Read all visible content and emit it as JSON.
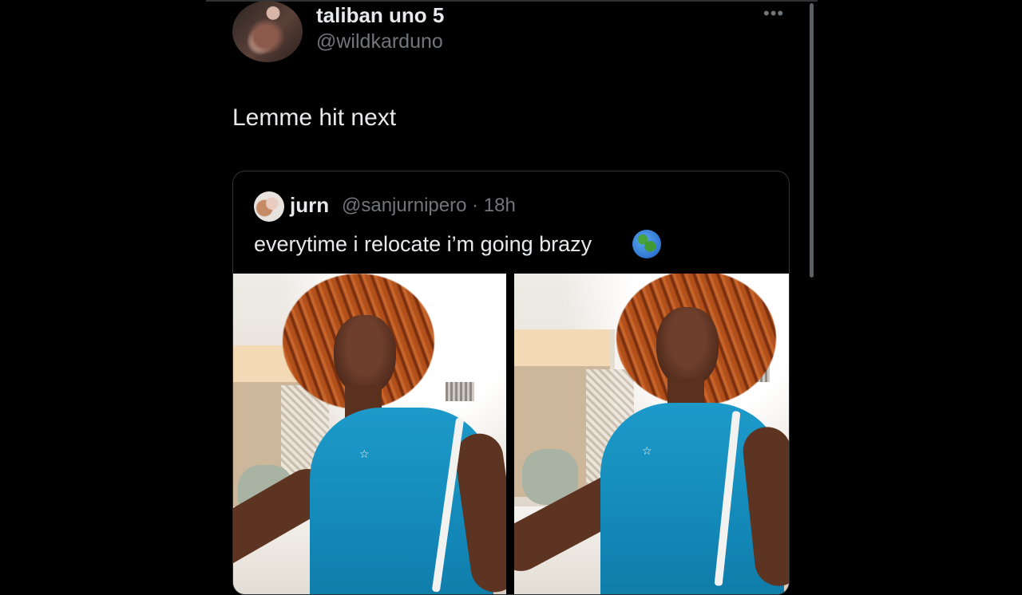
{
  "tweet": {
    "author_name": "taliban uno 5",
    "author_handle": "@wildkarduno",
    "more_icon": "more-horizontal-icon",
    "text": "Lemme hit next"
  },
  "quoted": {
    "author_name": "jurn",
    "meta": "@sanjurnipero · 18h",
    "text": "everytime i relocate i’m going brazy",
    "emoji_icon": "globe-americas-icon",
    "photos": [
      "photo-1",
      "photo-2"
    ]
  },
  "colors": {
    "background": "#000000",
    "text": "#e7e9ea",
    "secondary_text": "#71767b",
    "border": "#2f3336"
  }
}
